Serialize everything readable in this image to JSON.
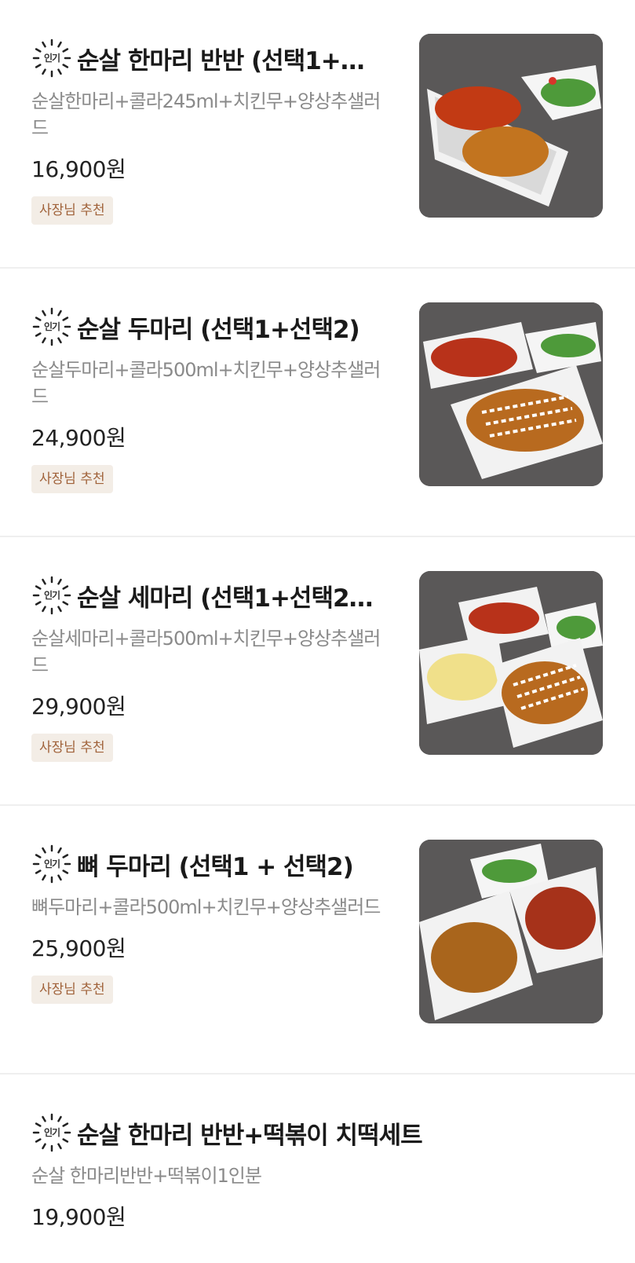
{
  "popular_label": "인기",
  "items": [
    {
      "title": "순살 한마리 반반 (선택1+…",
      "desc": "순살한마리+콜라245ml+치킨무+양상추샐러드",
      "price": "16,900원",
      "tag": "사장님 추천",
      "photo_icon": "boneless-chicken-half-half-photo"
    },
    {
      "title": "순살 두마리 (선택1+선택2)",
      "desc": "순살두마리+콜라500ml+치킨무+양상추샐러드",
      "price": "24,900원",
      "tag": "사장님 추천",
      "photo_icon": "boneless-chicken-two-photo"
    },
    {
      "title": "순살 세마리 (선택1+선택2…",
      "desc": "순살세마리+콜라500ml+치킨무+양상추샐러드",
      "price": "29,900원",
      "tag": "사장님 추천",
      "photo_icon": "boneless-chicken-three-photo"
    },
    {
      "title": "뼈 두마리 (선택1 + 선택2)",
      "desc": "뼈두마리+콜라500ml+치킨무+양상추샐러드",
      "price": "25,900원",
      "tag": "사장님 추천",
      "photo_icon": "bone-in-chicken-two-photo"
    },
    {
      "title": "순살 한마리 반반+떡볶이 치떡세트",
      "desc": "순살 한마리반반+떡볶이1인분",
      "price": "19,900원"
    }
  ],
  "colors": {
    "tag_bg": "#f3ede6",
    "tag_text": "#a0623a",
    "desc_text": "#8a8a8a",
    "divider": "#efefef"
  }
}
